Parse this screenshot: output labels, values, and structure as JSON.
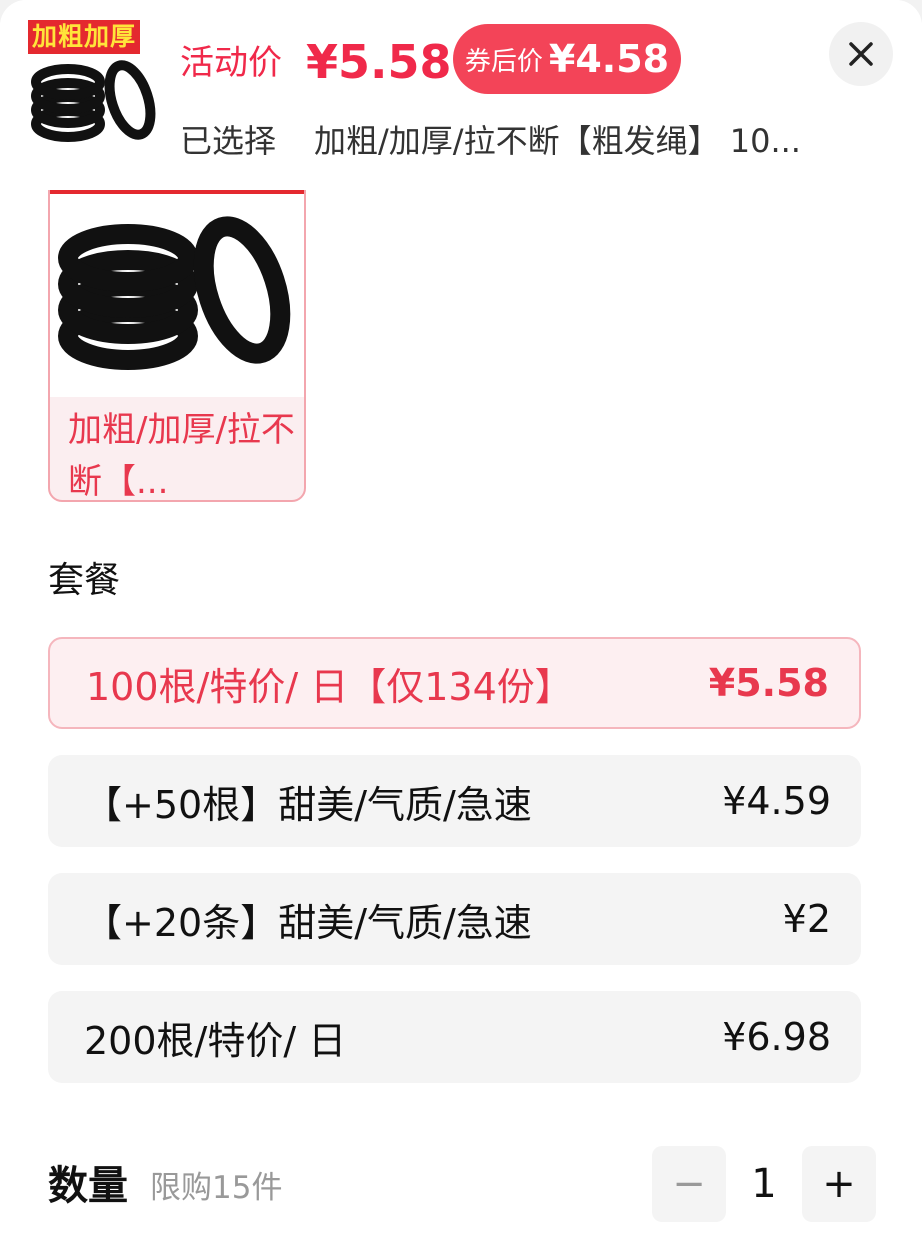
{
  "header": {
    "thumb_banner": "加粗加厚",
    "activity_label": "活动价",
    "activity_price": "¥5.58",
    "coupon_label": "券后价",
    "coupon_price": "¥4.58",
    "selected_label": "已选择",
    "selected_value": "加粗/加厚/拉不断【粗发绳】 10..."
  },
  "color_option": {
    "label": "加粗/加厚/拉不断【..."
  },
  "packages": {
    "title": "套餐",
    "items": [
      {
        "name": "100根/特价/ 日【仅134份】",
        "price": "¥5.58",
        "selected": true
      },
      {
        "name": "【+50根】甜美/气质/急速",
        "price": "¥4.59",
        "selected": false
      },
      {
        "name": "【+20条】甜美/气质/急速",
        "price": "¥2",
        "selected": false
      },
      {
        "name": "200根/特价/ 日",
        "price": "¥6.98",
        "selected": false
      }
    ]
  },
  "quantity": {
    "title": "数量",
    "limit": "限购15件",
    "minus": "−",
    "value": "1",
    "plus": "+"
  },
  "colors": {
    "accent": "#f0294a",
    "coupon_bg": "#f34458",
    "selected_border": "#f5b6bd"
  },
  "icons": [
    "close-icon",
    "product-thumbnail",
    "minus-icon",
    "plus-icon"
  ]
}
